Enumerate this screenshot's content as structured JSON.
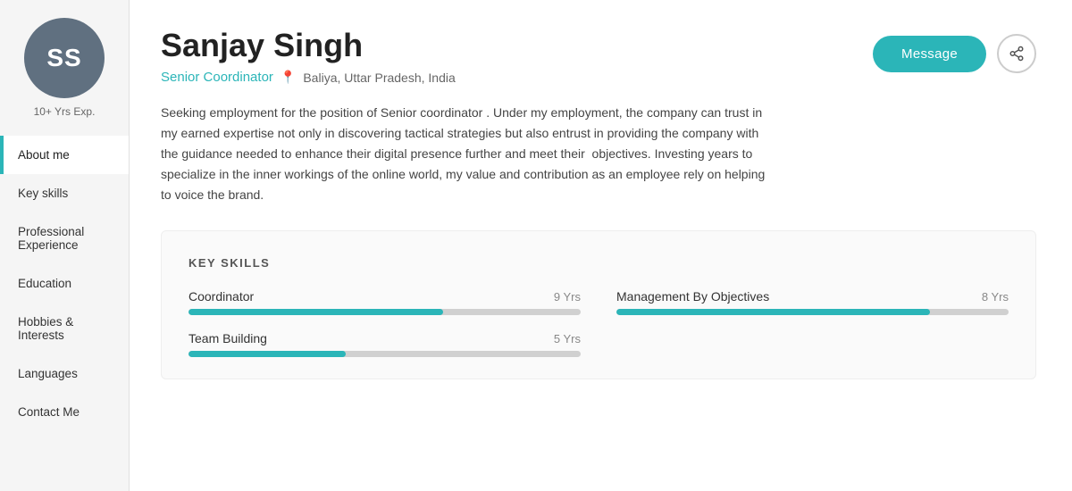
{
  "sidebar": {
    "avatar": {
      "initials": "SS",
      "exp_label": "10+ Yrs Exp."
    },
    "nav_items": [
      {
        "id": "about-me",
        "label": "About me",
        "active": true
      },
      {
        "id": "key-skills",
        "label": "Key skills",
        "active": false
      },
      {
        "id": "professional-experience",
        "label": "Professional Experience",
        "active": false
      },
      {
        "id": "education",
        "label": "Education",
        "active": false
      },
      {
        "id": "hobbies-interests",
        "label": "Hobbies & Interests",
        "active": false
      },
      {
        "id": "languages",
        "label": "Languages",
        "active": false
      },
      {
        "id": "contact-me",
        "label": "Contact Me",
        "active": false
      }
    ]
  },
  "profile": {
    "name": "Sanjay Singh",
    "title": "Senior Coordinator",
    "location": "Baliya, Uttar Pradesh, India",
    "about": "Seeking employment for the position of Senior coordinator . Under my employment, the company can trust in my earned expertise not only in discovering tactical strategies but also entrust in providing the company with the guidance needed to enhance their digital presence further and meet their&nbsp; objectives. Investing years to specialize in the inner workings of the online world, my value and contribution as an employee rely on helping to voice the brand.&nbsp;",
    "message_btn": "Message"
  },
  "skills": {
    "section_title": "KEY SKILLS",
    "items": [
      {
        "name": "Coordinator",
        "years": "9 Yrs",
        "percent": 65
      },
      {
        "name": "Management By Objectives",
        "years": "8 Yrs",
        "percent": 80
      },
      {
        "name": "Team Building",
        "years": "5 Yrs",
        "percent": 40
      }
    ]
  }
}
